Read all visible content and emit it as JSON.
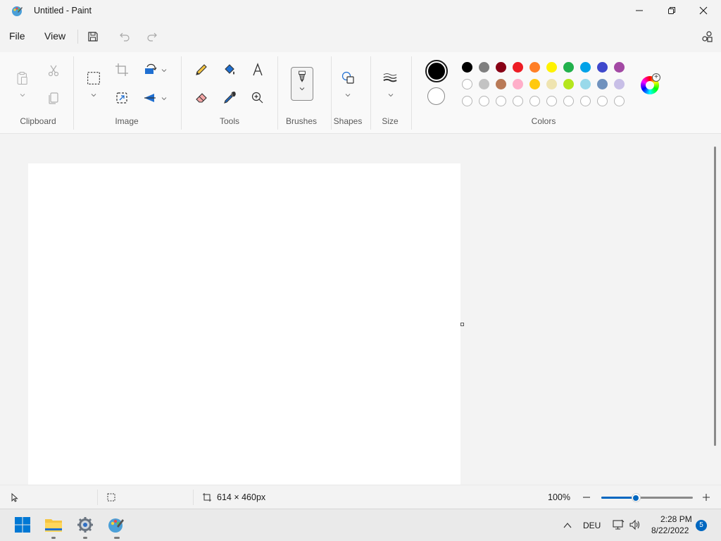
{
  "window": {
    "title": "Untitled - Paint"
  },
  "menu": {
    "file": "File",
    "view": "View"
  },
  "ribbon": {
    "groups": {
      "clipboard": "Clipboard",
      "image": "Image",
      "tools": "Tools",
      "brushes": "Brushes",
      "shapes": "Shapes",
      "size": "Size",
      "colors": "Colors"
    }
  },
  "colors": {
    "primary": "#000000",
    "secondary": "#ffffff",
    "palette_row1": [
      "#000000",
      "#7f7f7f",
      "#880015",
      "#ed1c24",
      "#ff7f27",
      "#fff200",
      "#22b14c",
      "#00a2e8",
      "#3f48cc",
      "#a349a4"
    ],
    "palette_row2": [
      "#ffffff",
      "#c3c3c3",
      "#b97a57",
      "#ffaec9",
      "#ffc90e",
      "#efe4b0",
      "#b5e61d",
      "#99d9ea",
      "#7092be",
      "#c8bfe7"
    ],
    "palette_row3": [
      "",
      "",
      "",
      "",
      "",
      "",
      "",
      "",
      "",
      ""
    ],
    "accent": "#0067c0"
  },
  "statusbar": {
    "canvas_size": "614 × 460px",
    "zoom": "100%",
    "zoom_level_fraction": 0.38
  },
  "taskbar": {
    "language": "DEU",
    "time": "2:28 PM",
    "date": "8/22/2022",
    "notifications": "5"
  }
}
